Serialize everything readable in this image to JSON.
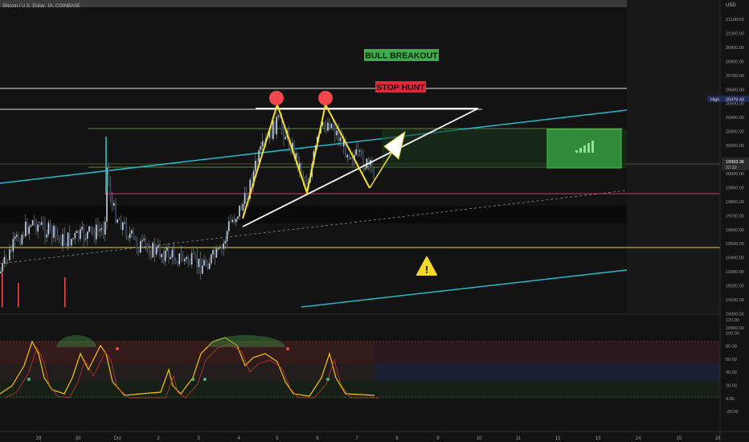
{
  "symbol": "Bitcoin / U.S. Dollar, 1h, COINBASE",
  "currency": "USD",
  "annotations": {
    "bull_breakout": "BULL BREAKOUT",
    "stop_hunt": "STOP HUNT",
    "warning": "!"
  },
  "price_axis": {
    "ticks": [
      "21100.00",
      "21000.00",
      "20900.00",
      "20800.00",
      "20700.00",
      "20600.00",
      "20500.00",
      "20400.00",
      "20300.00",
      "20200.00",
      "20100.00",
      "20000.00",
      "19900.00",
      "19800.00",
      "19700.00",
      "19600.00",
      "19500.00",
      "19400.00",
      "19300.00",
      "19200.00",
      "19100.00",
      "19000.00",
      "18900.00"
    ],
    "high_label": "High",
    "high_value": "20479.43",
    "current_price": "19993.36",
    "countdown": "22:32"
  },
  "osc_axis": {
    "ticks": [
      "120.00",
      "100.00",
      "80.00",
      "60.00",
      "40.00",
      "20.00",
      "0.00",
      "-20.00"
    ]
  },
  "time_axis": {
    "ticks": [
      "29",
      "30",
      "Oct",
      "2",
      "3",
      "4",
      "5",
      "6",
      "7",
      "8",
      "9",
      "10",
      "11",
      "12",
      "13",
      "14",
      "15",
      "16"
    ]
  },
  "chart_data": {
    "type": "line",
    "title": "Bitcoin / U.S. Dollar, 1h, COINBASE",
    "ylim": [
      18850,
      21150
    ],
    "levels": {
      "high": 20479.43,
      "last": 19993.36
    },
    "pattern_points": [
      {
        "x": "4",
        "y": 19560
      },
      {
        "x": "5",
        "y": 20420
      },
      {
        "x": "5.75",
        "y": 19750
      },
      {
        "x": "6.2",
        "y": 20420
      },
      {
        "x": "7.3",
        "y": 19770
      }
    ],
    "oscillator": {
      "ylim": [
        -30,
        125
      ],
      "upper_band": 75,
      "lower_band": 25
    }
  },
  "colors": {
    "up": "#26a69a",
    "down": "#ef5350",
    "accent_cyan": "#22bcc9",
    "yellow": "#f5e12f",
    "green_label": "#3dae4a",
    "red_label": "#e02a3c"
  }
}
